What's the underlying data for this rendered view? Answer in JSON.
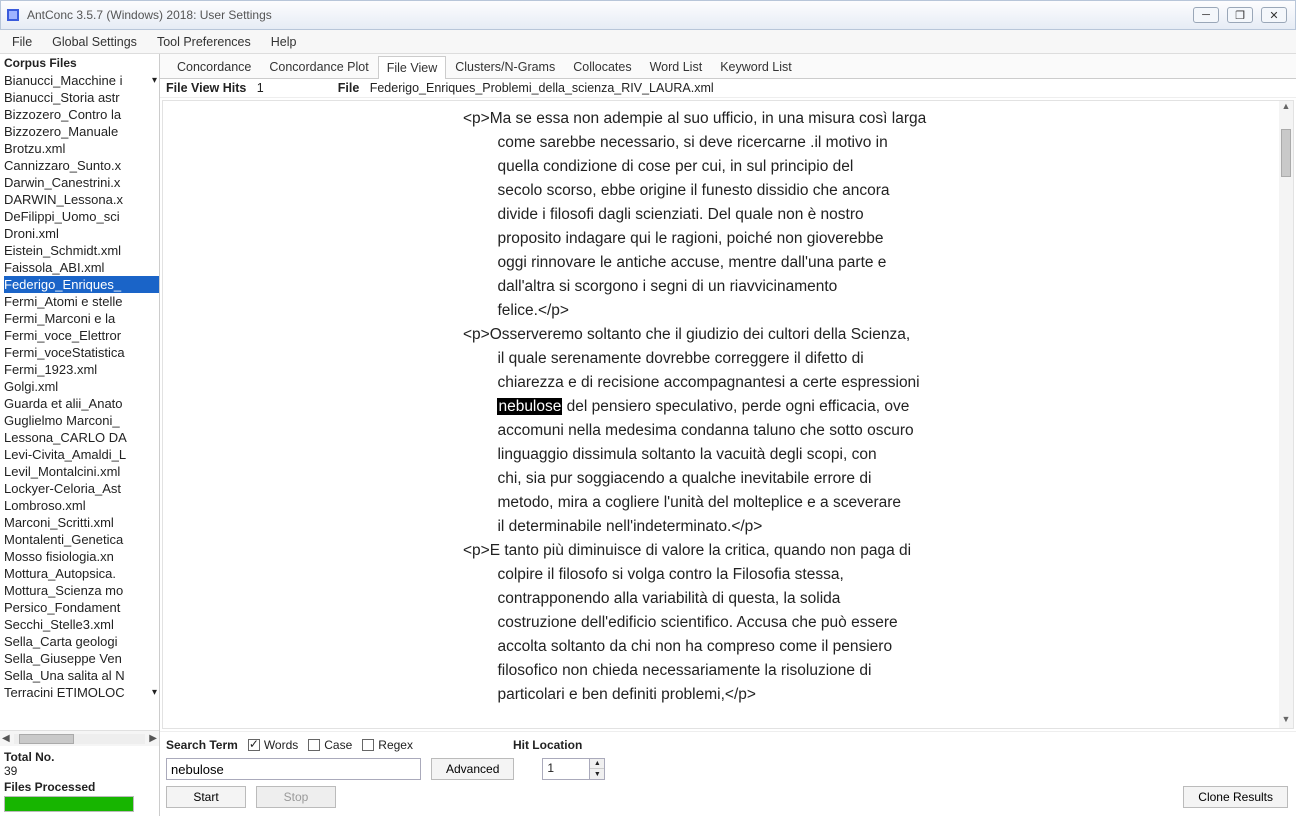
{
  "window": {
    "title": "AntConc 3.5.7 (Windows) 2018: User Settings"
  },
  "menu": [
    "File",
    "Global Settings",
    "Tool Preferences",
    "Help"
  ],
  "sidebar": {
    "title": "Corpus Files",
    "files": [
      "Bianucci_Macchine i",
      "Bianucci_Storia astr",
      "Bizzozero_Contro la",
      "Bizzozero_Manuale",
      "Brotzu.xml",
      "Cannizzaro_Sunto.x",
      "Darwin_Canestrini.x",
      "DARWIN_Lessona.x",
      "DeFilippi_Uomo_sci",
      "Droni.xml",
      "Eistein_Schmidt.xml",
      "Faissola_ABI.xml",
      "Federigo_Enriques_",
      "Fermi_Atomi e stelle",
      "Fermi_Marconi e la",
      "Fermi_voce_Elettror",
      "Fermi_voceStatistica",
      "Fermi_1923.xml",
      "Golgi.xml",
      "Guarda et alii_Anato",
      "Guglielmo Marconi_",
      "Lessona_CARLO DA",
      "Levi-Civita_Amaldi_L",
      "Levil_Montalcini.xml",
      "Lockyer-Celoria_Ast",
      "Lombroso.xml",
      "Marconi_Scritti.xml",
      "Montalenti_Genetica",
      "Mosso fisiologia.xn",
      "Mottura_Autopsica.",
      "Mottura_Scienza mo",
      "Persico_Fondament",
      "Secchi_Stelle3.xml",
      "Sella_Carta geologi",
      "Sella_Giuseppe Ven",
      "Sella_Una salita al N",
      "Terracini ETIMOLOC"
    ],
    "selected_index": 12,
    "total_label": "Total No.",
    "total_value": "39",
    "files_processed_label": "Files Processed"
  },
  "tabs": [
    "Concordance",
    "Concordance Plot",
    "File View",
    "Clusters/N-Grams",
    "Collocates",
    "Word List",
    "Keyword List"
  ],
  "active_tab": 2,
  "infobar": {
    "hits_label": "File View Hits",
    "hits_value": "1",
    "file_label": "File",
    "file_value": "Federigo_Enriques_Problemi_della_scienza_RIV_LAURA.xml"
  },
  "fileview": {
    "pre": "<p>Ma se essa non adempie al suo ufficio, in una misura così larga\n        come sarebbe necessario, si deve ricercarne .il motivo in\n        quella condizione di cose per cui, in sul principio del\n        secolo scorso, ebbe origine il funesto dissidio che ancora\n        divide i filosofi dagli scienziati. Del quale non è nostro\n        proposito indagare qui le ragioni, poiché non gioverebbe\n        oggi rinnovare le antiche accuse, mentre dall'una parte e\n        dall'altra si scorgono i segni di un riavvicinamento\n        felice.</p>\n<p>Osserveremo soltanto che il giudizio dei cultori della Scienza,\n        il quale serenamente dovrebbe correggere il difetto di\n        chiarezza e di recisione accompagnantesi a certe espressioni\n        ",
    "hit": "nebulose",
    "post": " del pensiero speculativo, perde ogni efficacia, ove\n        accomuni nella medesima condanna taluno che sotto oscuro\n        linguaggio dissimula soltanto la vacuità degli scopi, con\n        chi, sia pur soggiacendo a qualche inevitabile errore di\n        metodo, mira a cogliere l'unità del molteplice e a sceverare\n        il determinabile nell'indeterminato.</p>\n<p>E tanto più diminuisce di valore la critica, quando non paga di\n        colpire il filosofo si volga contro la Filosofia stessa,\n        contrapponendo alla variabilità di questa, la solida\n        costruzione dell'edificio scientifico. Accusa che può essere\n        accolta soltanto da chi non ha compreso come il pensiero\n        filosofico non chieda necessariamente la risoluzione di\n        particolari e ben definiti problemi,</p>"
  },
  "controls": {
    "search_term_label": "Search Term",
    "words_label": "Words",
    "case_label": "Case",
    "regex_label": "Regex",
    "search_value": "nebulose",
    "advanced_label": "Advanced",
    "start_label": "Start",
    "stop_label": "Stop",
    "hit_location_label": "Hit Location",
    "hit_location_value": "1",
    "clone_label": "Clone Results"
  }
}
